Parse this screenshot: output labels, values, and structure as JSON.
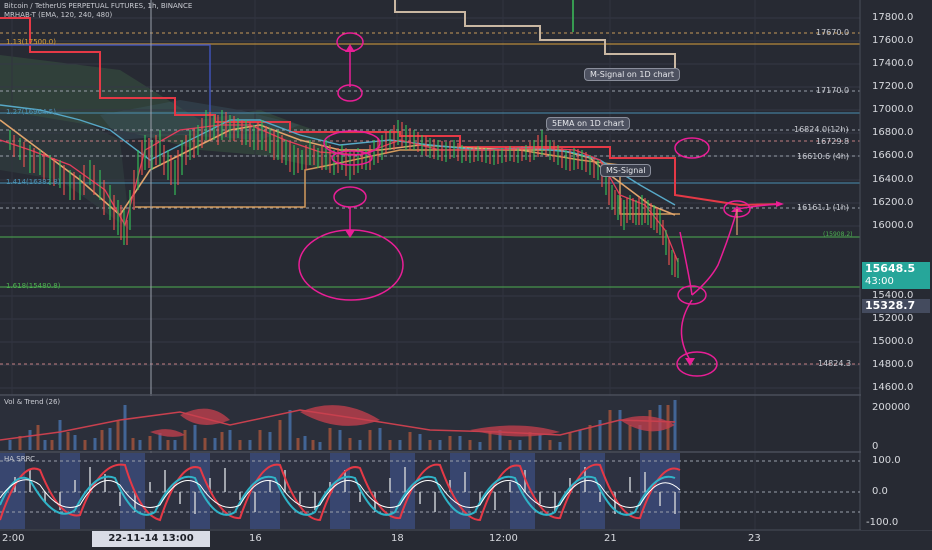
{
  "header": {
    "symbol_line": "Bitcoin / TetherUS PERPETUAL FUTURES, 1h, BINANCE",
    "indicator_line": "MRHAB-T (EMA, 120, 240, 480)"
  },
  "price_axis": {
    "labels": [
      "17800.0",
      "17600.0",
      "17400.0",
      "17200.0",
      "17000.0",
      "16800.0",
      "16600.0",
      "16400.0",
      "16200.0",
      "16000.0",
      "15400.0",
      "15200.0",
      "15000.0",
      "14800.0",
      "14600.0"
    ]
  },
  "price_tags": {
    "last_price": "15648.5",
    "countdown": "43:00",
    "cursor_price": "15328.7"
  },
  "levels": [
    {
      "text": "17670.0"
    },
    {
      "text": "17170.0"
    },
    {
      "text": "16824.0(12h)"
    },
    {
      "text": "16729.8"
    },
    {
      "text": "16610.6 (4h)"
    },
    {
      "text": "16161.1 (1h)"
    },
    {
      "text": "(15908.2)"
    },
    {
      "text": "14824.3"
    }
  ],
  "fib_labels": [
    {
      "text": "1.13(17500.0)"
    },
    {
      "text": "1.27(16964.5)"
    },
    {
      "text": "1.414(16382.8)"
    },
    {
      "text": "1.618(15480.8)"
    }
  ],
  "callouts": {
    "msignal_1d": "M-Signal on 1D chart",
    "ema_1d": "5EMA on 1D chart",
    "ms_signal": "MS-Signal"
  },
  "vol_pane": {
    "title": "Vol & Trend (26)",
    "labels": [
      "200000",
      "0"
    ]
  },
  "osc_pane": {
    "title": "HA SRRC",
    "labels": [
      "100.0",
      "0.0",
      "-100.0"
    ]
  },
  "time_axis": {
    "labels": [
      "2:00",
      "16",
      "18",
      "12:00",
      "21",
      "23"
    ],
    "cursor_time": "22-11-14   13:00"
  },
  "colors": {
    "background": "#272a33",
    "green_level": "#4caf50",
    "red_line": "#e53946",
    "magenta": "#e91e96",
    "orange_line": "#d29a5c",
    "last_price_tag": "#26a69a",
    "cursor_tag": "#444b5e"
  }
}
